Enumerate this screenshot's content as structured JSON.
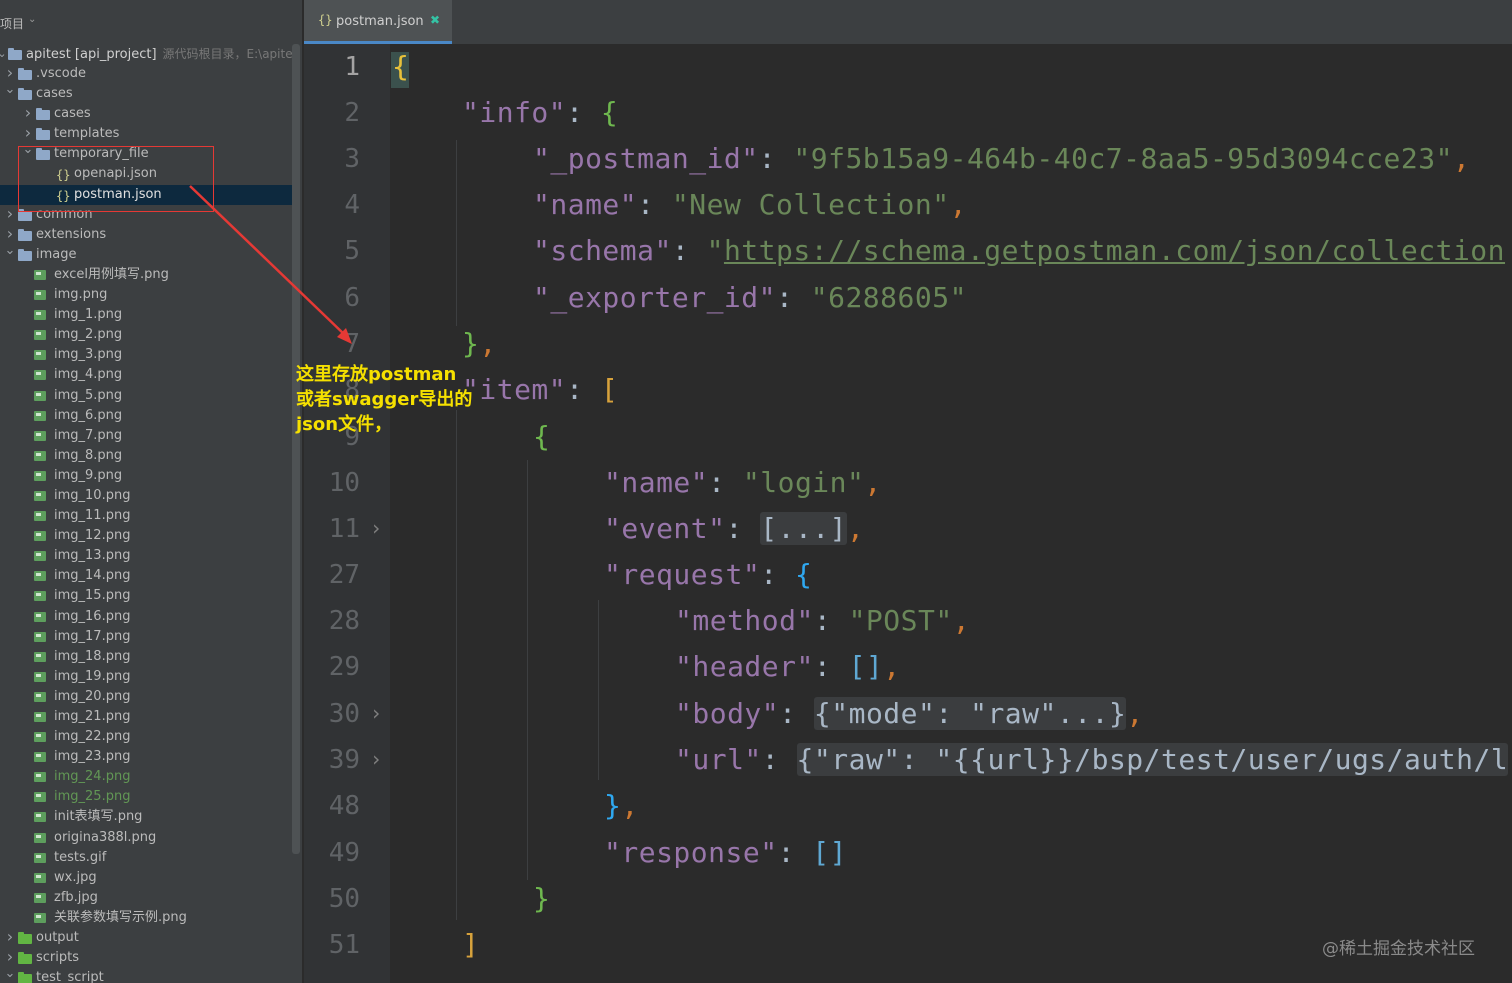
{
  "project_panel": {
    "title": "项目",
    "root": {
      "label": "apitest [api_project]",
      "extra": "源代码根目录，E:\\apite"
    },
    "tree": [
      {
        "label": ".vscode",
        "type": "folder",
        "depth": 1,
        "expanded": false
      },
      {
        "label": "cases",
        "type": "folder",
        "depth": 1,
        "expanded": true
      },
      {
        "label": "cases",
        "type": "folder",
        "depth": 2,
        "expanded": false
      },
      {
        "label": "templates",
        "type": "folder",
        "depth": 2,
        "expanded": false
      },
      {
        "label": "temporary_file",
        "type": "folder",
        "depth": 2,
        "expanded": true
      },
      {
        "label": "openapi.json",
        "type": "json",
        "depth": 3
      },
      {
        "label": "postman.json",
        "type": "json",
        "depth": 3,
        "selected": true
      },
      {
        "label": "common",
        "type": "folder",
        "depth": 1,
        "expanded": false
      },
      {
        "label": "extensions",
        "type": "folder",
        "depth": 1,
        "expanded": false
      },
      {
        "label": "image",
        "type": "folder",
        "depth": 1,
        "expanded": true
      },
      {
        "label": "excel用例填写.png",
        "type": "image",
        "depth": 2
      },
      {
        "label": "img.png",
        "type": "image",
        "depth": 2
      },
      {
        "label": "img_1.png",
        "type": "image",
        "depth": 2
      },
      {
        "label": "img_2.png",
        "type": "image",
        "depth": 2
      },
      {
        "label": "img_3.png",
        "type": "image",
        "depth": 2
      },
      {
        "label": "img_4.png",
        "type": "image",
        "depth": 2
      },
      {
        "label": "img_5.png",
        "type": "image",
        "depth": 2
      },
      {
        "label": "img_6.png",
        "type": "image",
        "depth": 2
      },
      {
        "label": "img_7.png",
        "type": "image",
        "depth": 2
      },
      {
        "label": "img_8.png",
        "type": "image",
        "depth": 2
      },
      {
        "label": "img_9.png",
        "type": "image",
        "depth": 2
      },
      {
        "label": "img_10.png",
        "type": "image",
        "depth": 2
      },
      {
        "label": "img_11.png",
        "type": "image",
        "depth": 2
      },
      {
        "label": "img_12.png",
        "type": "image",
        "depth": 2
      },
      {
        "label": "img_13.png",
        "type": "image",
        "depth": 2
      },
      {
        "label": "img_14.png",
        "type": "image",
        "depth": 2
      },
      {
        "label": "img_15.png",
        "type": "image",
        "depth": 2
      },
      {
        "label": "img_16.png",
        "type": "image",
        "depth": 2
      },
      {
        "label": "img_17.png",
        "type": "image",
        "depth": 2
      },
      {
        "label": "img_18.png",
        "type": "image",
        "depth": 2
      },
      {
        "label": "img_19.png",
        "type": "image",
        "depth": 2
      },
      {
        "label": "img_20.png",
        "type": "image",
        "depth": 2
      },
      {
        "label": "img_21.png",
        "type": "image",
        "depth": 2
      },
      {
        "label": "img_22.png",
        "type": "image",
        "depth": 2
      },
      {
        "label": "img_23.png",
        "type": "image",
        "depth": 2
      },
      {
        "label": "img_24.png",
        "type": "image",
        "depth": 2,
        "vcs": "added"
      },
      {
        "label": "img_25.png",
        "type": "image",
        "depth": 2,
        "vcs": "added"
      },
      {
        "label": "init表填写.png",
        "type": "image",
        "depth": 2
      },
      {
        "label": "origina388l.png",
        "type": "image",
        "depth": 2
      },
      {
        "label": "tests.gif",
        "type": "image",
        "depth": 2
      },
      {
        "label": "wx.jpg",
        "type": "image",
        "depth": 2
      },
      {
        "label": "zfb.jpg",
        "type": "image",
        "depth": 2
      },
      {
        "label": "关联参数填写示例.png",
        "type": "image",
        "depth": 2
      },
      {
        "label": "output",
        "type": "folder",
        "depth": 1,
        "expanded": false
      },
      {
        "label": "scripts",
        "type": "folder",
        "depth": 1,
        "expanded": false
      },
      {
        "label": "test_script",
        "type": "folder",
        "depth": 1,
        "expanded": true
      }
    ]
  },
  "editor": {
    "tab": {
      "label": "postman.json",
      "icon": "json-file-icon"
    },
    "line_numbers": [
      "1",
      "2",
      "3",
      "4",
      "5",
      "6",
      "7",
      "8",
      "9",
      "10",
      "11",
      "27",
      "28",
      "29",
      "30",
      "39",
      "48",
      "49",
      "50",
      "51"
    ],
    "code": {
      "l2_key": "\"info\"",
      "l3_key": "\"_postman_id\"",
      "l3_val": "\"9f5b15a9-464b-40c7-8aa5-95d3094cce23\"",
      "l4_key": "\"name\"",
      "l4_val": "\"New Collection\"",
      "l5_key": "\"schema\"",
      "l5_val_q": "\"",
      "l5_val": "https://schema.getpostman.com/json/collection",
      "l6_key": "\"_exporter_id\"",
      "l6_val": "\"6288605\"",
      "l8_key": "\"item\"",
      "l10_key": "\"name\"",
      "l10_val": "\"login\"",
      "l11_key": "\"event\"",
      "l11_folded": "[...]",
      "l27_key": "\"request\"",
      "l28_key": "\"method\"",
      "l28_val": "\"POST\"",
      "l29_key": "\"header\"",
      "l29_val": "[]",
      "l30_key": "\"body\"",
      "l30_folded": "{\"mode\": \"raw\"...}",
      "l39_key": "\"url\"",
      "l39_folded": "{\"raw\": \"{{url}}/bsp/test/user/ugs/auth/l",
      "l49_key": "\"response\"",
      "l49_val": "[]"
    }
  },
  "annotation": {
    "lines": [
      "这里存放postman",
      "或者swagger导出的",
      "json文件，"
    ],
    "color": "#f5e000"
  },
  "watermark": "@稀土掘金技术社区",
  "colors": {
    "key": "#9876aa",
    "string": "#6a8759",
    "punct": "#cc7832",
    "selection": "#0d293e",
    "annotation_red": "#e53935"
  }
}
